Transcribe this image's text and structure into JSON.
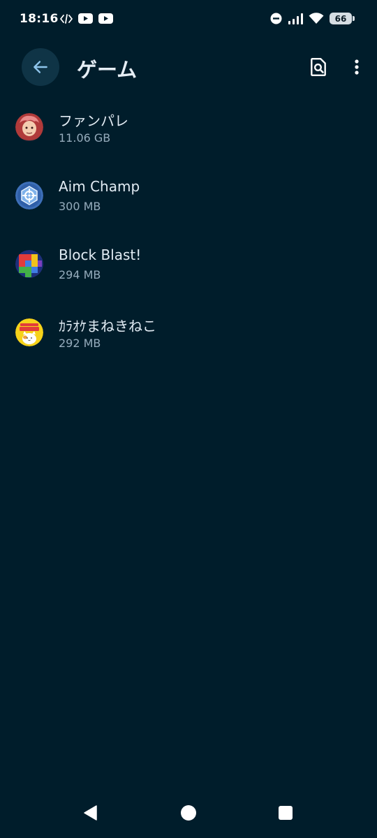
{
  "status_bar": {
    "time": "18:16",
    "battery": "66",
    "icons": [
      "code-icon",
      "youtube-icon",
      "youtube-icon",
      "dnd-icon",
      "signal-icon",
      "wifi-icon",
      "battery-icon"
    ]
  },
  "app_bar": {
    "title": "ゲーム",
    "back_icon": "arrow-back-icon",
    "actions": [
      "document-search-icon",
      "more-vert-icon"
    ]
  },
  "apps": [
    {
      "name": "ファンパレ",
      "size": "11.06 GB",
      "icon": "fanpare-app-icon"
    },
    {
      "name": "Aim Champ",
      "size": "300 MB",
      "icon": "aim-champ-app-icon"
    },
    {
      "name": "Block Blast!",
      "size": "294 MB",
      "icon": "block-blast-app-icon"
    },
    {
      "name": "ｶﾗｵｹまねきねこ",
      "size": "292 MB",
      "icon": "karaoke-maneki-neko-app-icon"
    }
  ],
  "colors": {
    "background": "#001d2b",
    "back_button_bg": "#0f3446",
    "accent": "#8fc5ec",
    "text_primary": "#e2ecf4",
    "text_secondary": "#96acbc"
  },
  "nav_bar": [
    "nav-back-icon",
    "nav-home-icon",
    "nav-recents-icon"
  ]
}
